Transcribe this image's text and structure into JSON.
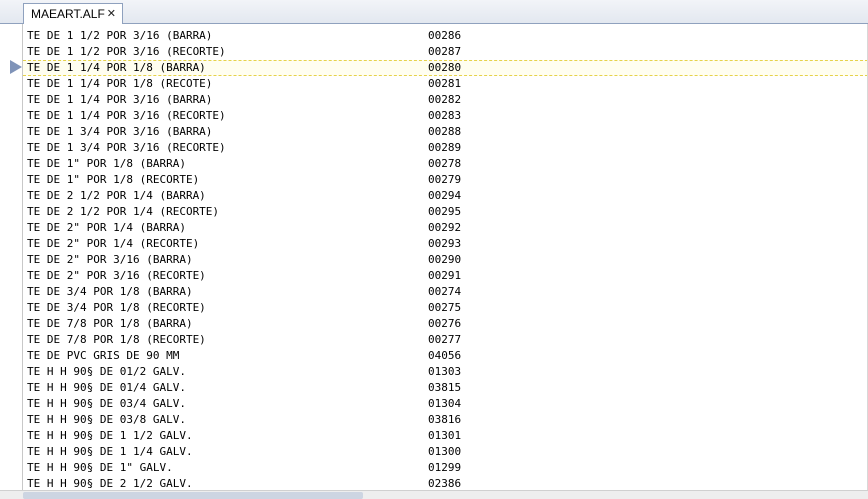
{
  "tab": {
    "title": "MAEART.ALF",
    "close": "✕"
  },
  "rows": [
    {
      "desc": "TE DE 1 1/2 POR 3/16 (BARRA)",
      "code": "00286"
    },
    {
      "desc": "TE DE 1 1/2 POR 3/16 (RECORTE)",
      "code": "00287"
    },
    {
      "desc": "TE DE 1 1/4 POR 1/8 (BARRA)",
      "code": "00280"
    },
    {
      "desc": "TE DE 1 1/4 POR 1/8 (RECOTE)",
      "code": "00281"
    },
    {
      "desc": "TE DE 1 1/4 POR 3/16 (BARRA)",
      "code": "00282"
    },
    {
      "desc": "TE DE 1 1/4 POR 3/16 (RECORTE)",
      "code": "00283"
    },
    {
      "desc": "TE DE 1 3/4 POR 3/16 (BARRA)",
      "code": "00288"
    },
    {
      "desc": "TE DE 1 3/4 POR 3/16 (RECORTE)",
      "code": "00289"
    },
    {
      "desc": "TE DE 1\" POR 1/8 (BARRA)",
      "code": "00278"
    },
    {
      "desc": "TE DE 1\" POR 1/8 (RECORTE)",
      "code": "00279"
    },
    {
      "desc": "TE DE 2 1/2 POR 1/4 (BARRA)",
      "code": "00294"
    },
    {
      "desc": "TE DE 2 1/2 POR 1/4 (RECORTE)",
      "code": "00295"
    },
    {
      "desc": "TE DE 2\" POR 1/4 (BARRA)",
      "code": "00292"
    },
    {
      "desc": "TE DE 2\" POR 1/4 (RECORTE)",
      "code": "00293"
    },
    {
      "desc": "TE DE 2\" POR 3/16 (BARRA)",
      "code": "00290"
    },
    {
      "desc": "TE DE 2\" POR 3/16 (RECORTE)",
      "code": "00291"
    },
    {
      "desc": "TE DE 3/4 POR 1/8 (BARRA)",
      "code": "00274"
    },
    {
      "desc": "TE DE 3/4 POR 1/8 (RECORTE)",
      "code": "00275"
    },
    {
      "desc": "TE DE 7/8 POR 1/8 (BARRA)",
      "code": "00276"
    },
    {
      "desc": "TE DE 7/8 POR 1/8 (RECORTE)",
      "code": "00277"
    },
    {
      "desc": "TE DE PVC GRIS DE 90 MM",
      "code": "04056"
    },
    {
      "desc": "TE H H 90§ DE 01/2 GALV.",
      "code": "01303"
    },
    {
      "desc": "TE H H 90§ DE 01/4 GALV.",
      "code": "03815"
    },
    {
      "desc": "TE H H 90§ DE 03/4 GALV.",
      "code": "01304"
    },
    {
      "desc": "TE H H 90§ DE 03/8 GALV.",
      "code": "03816"
    },
    {
      "desc": "TE H H 90§ DE 1 1/2 GALV.",
      "code": "01301"
    },
    {
      "desc": "TE H H 90§ DE 1 1/4 GALV.",
      "code": "01300"
    },
    {
      "desc": "TE H H 90§ DE 1\" GALV.",
      "code": "01299"
    },
    {
      "desc": "TE H H 90§ DE 2 1/2 GALV.",
      "code": "02386"
    }
  ],
  "current_row": 2
}
